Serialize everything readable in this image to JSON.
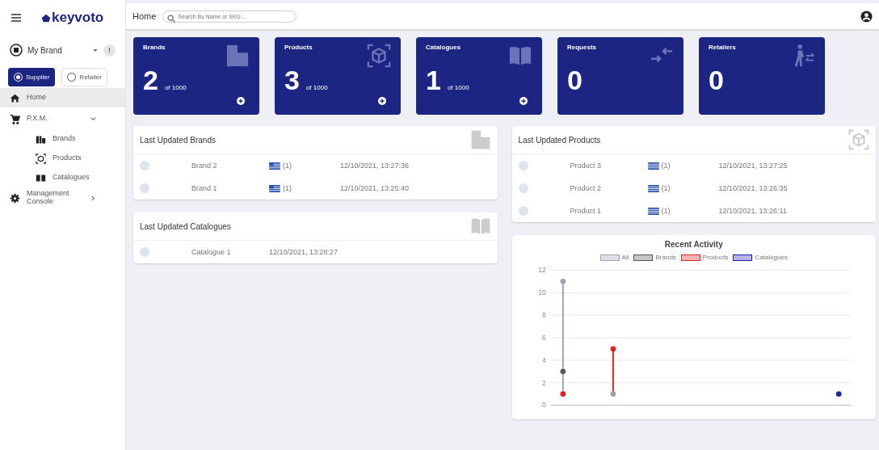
{
  "header": {
    "brand": "keyvoto",
    "breadcrumb": "Home",
    "search": {
      "placeholder": "Search By Name or SKU..."
    }
  },
  "account": {
    "name": "My Brand",
    "badge": "!"
  },
  "roles": [
    {
      "label": "Supplier",
      "selected": true
    },
    {
      "label": "Retailer",
      "selected": false
    }
  ],
  "nav": [
    {
      "label": "Home",
      "selected": true
    },
    {
      "label": "P.X.M.",
      "selected": false,
      "expanded": true,
      "children": [
        {
          "label": "Brands",
          "selected": false
        },
        {
          "label": "Products",
          "selected": false
        },
        {
          "label": "Catalogues",
          "selected": false
        }
      ]
    },
    {
      "label": "Management Console",
      "selected": false,
      "expanded": false
    }
  ],
  "stats": [
    {
      "title": "Brands",
      "value": "2",
      "limit": "of 1000",
      "add": true
    },
    {
      "title": "Products",
      "value": "3",
      "limit": "of 1000",
      "add": true
    },
    {
      "title": "Catalogues",
      "value": "1",
      "limit": "of 1000",
      "add": true
    },
    {
      "title": "Requests",
      "value": "0",
      "add": false
    },
    {
      "title": "Retailers",
      "value": "0",
      "add": false
    }
  ],
  "brands_panel": {
    "title": "Last Updated Brands",
    "rows": [
      {
        "name": "Brand 2",
        "flag": "(1)",
        "date": "12/10/2021, 13:27:36"
      },
      {
        "name": "Brand 1",
        "flag": "(1)",
        "date": "12/10/2021, 13:25:40"
      }
    ]
  },
  "catalogues_panel": {
    "title": "Last Updated Catalogues",
    "rows": [
      {
        "name": "Catalogue 1",
        "date": "12/10/2021, 13:28:27"
      }
    ]
  },
  "products_panel": {
    "title": "Last Updated Products",
    "rows": [
      {
        "name": "Product 3",
        "flag": "(1)",
        "date": "12/10/2021, 13:27:25"
      },
      {
        "name": "Product 2",
        "flag": "(1)",
        "date": "12/10/2021, 13:26:35"
      },
      {
        "name": "Product 1",
        "flag": "(1)",
        "date": "12/10/2021, 13:26:11"
      }
    ]
  },
  "activity": {
    "chart_data": {
      "type": "line",
      "title": "Recent Activity",
      "categories": [
        null,
        null,
        null,
        null,
        null,
        null,
        null,
        null,
        null,
        null,
        null,
        null
      ],
      "ylim": [
        0,
        12
      ],
      "grid": true,
      "legend": "top",
      "yticks": [
        0,
        2,
        4,
        6,
        8,
        10,
        12
      ],
      "series": [
        {
          "name": "All",
          "color": "#9aa3ad",
          "marker": "circle",
          "values": [
            11,
            null,
            1,
            null,
            null,
            null,
            null,
            null,
            null,
            null,
            null,
            null
          ]
        },
        {
          "name": "Brands",
          "color": "#555555",
          "marker": "circle",
          "values": [
            3,
            null,
            null,
            null,
            null,
            null,
            null,
            null,
            null,
            null,
            null,
            null
          ]
        },
        {
          "name": "Products",
          "color": "#e02020",
          "marker": "circle",
          "values": [
            1,
            null,
            5,
            null,
            null,
            null,
            null,
            null,
            null,
            null,
            null,
            null
          ]
        },
        {
          "name": "Catalogues",
          "color": "#2020b0",
          "marker": "circle",
          "values": [
            null,
            null,
            null,
            null,
            null,
            null,
            null,
            null,
            null,
            null,
            null,
            1
          ]
        }
      ]
    }
  }
}
